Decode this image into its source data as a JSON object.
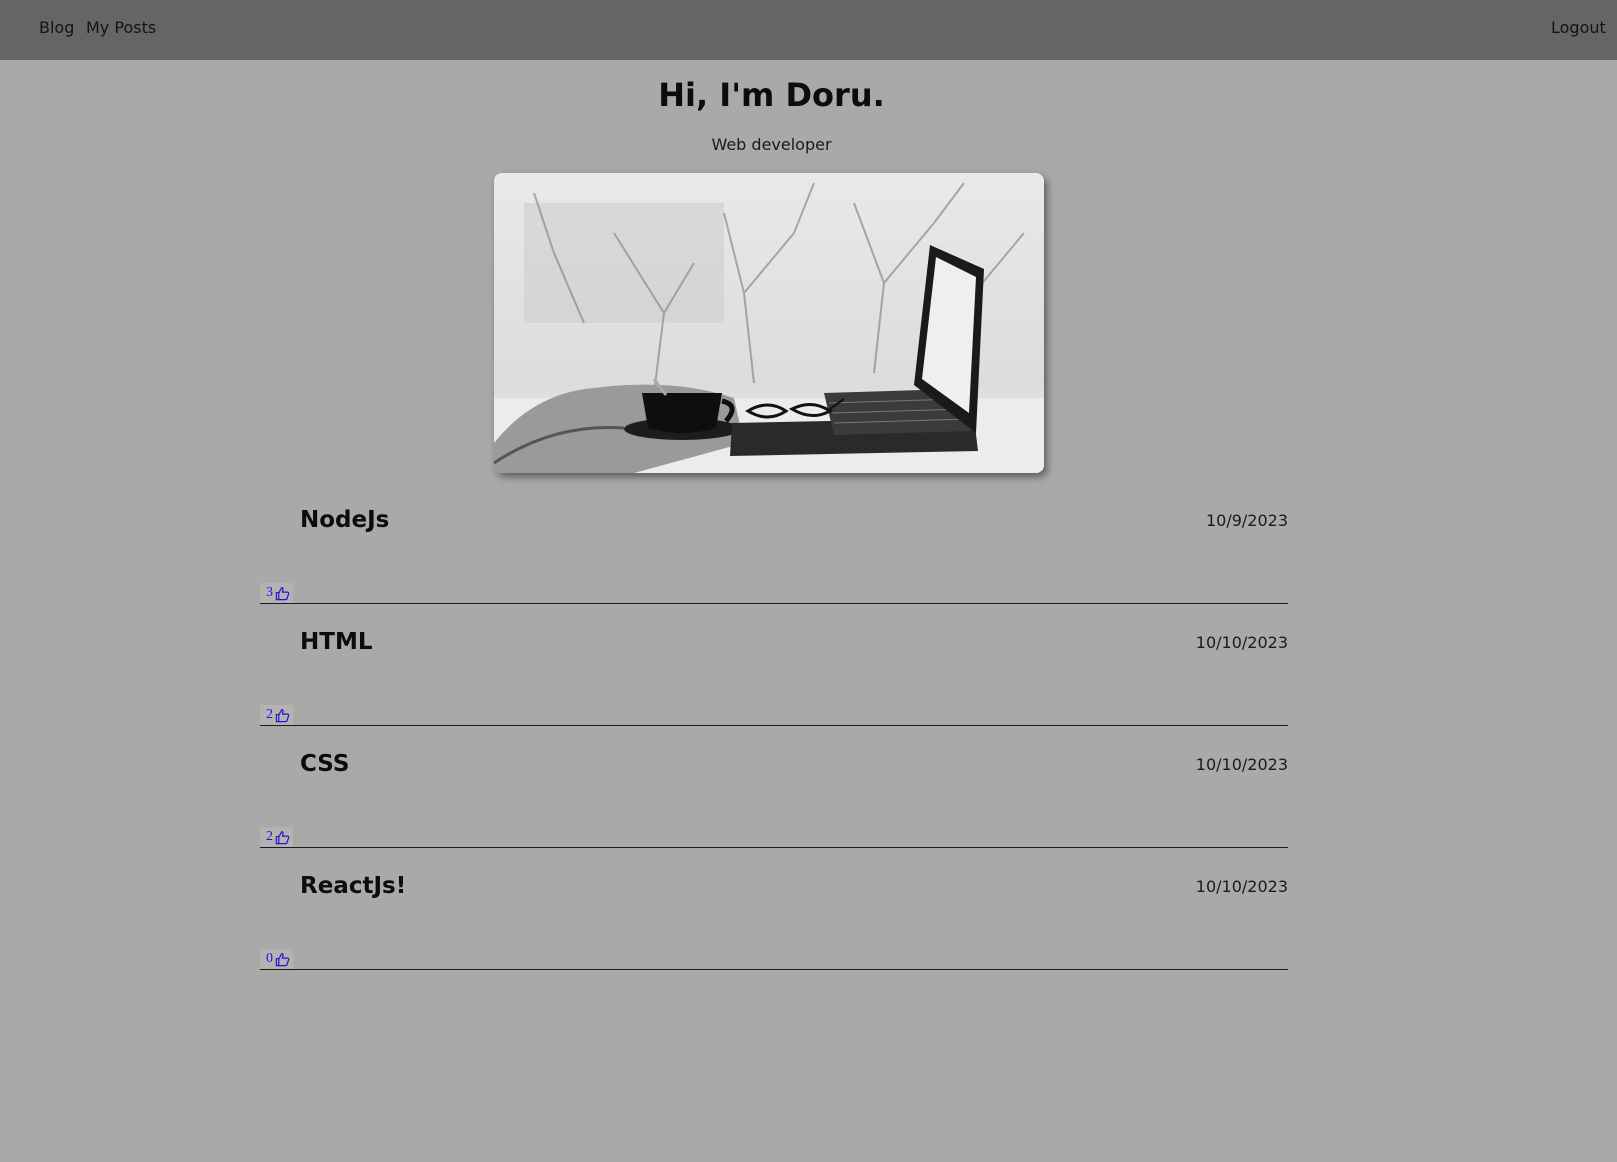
{
  "nav": {
    "blog_label": "Blog",
    "my_posts_label": "My Posts",
    "logout_label": "Logout"
  },
  "hero": {
    "title": "Hi, I'm Doru.",
    "subtitle": "Web developer",
    "image_icon": "laptop-coffee-winter-photo"
  },
  "posts": [
    {
      "title": "NodeJs",
      "date": "10/9/2023",
      "likes": "3"
    },
    {
      "title": "HTML",
      "date": "10/10/2023",
      "likes": "2"
    },
    {
      "title": "CSS",
      "date": "10/10/2023",
      "likes": "2"
    },
    {
      "title": "ReactJs!",
      "date": "10/10/2023",
      "likes": "0"
    }
  ],
  "colors": {
    "page_background": "#a9a9a9",
    "navbar_background": "#656565",
    "like_color": "#1a1ad6"
  }
}
